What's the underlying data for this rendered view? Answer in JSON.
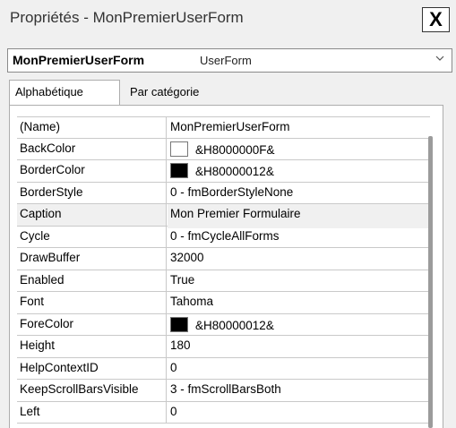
{
  "window": {
    "title": "Propriétés - MonPremierUserForm",
    "close_label": "X"
  },
  "object_selector": {
    "name": "MonPremierUserForm",
    "type": "UserForm"
  },
  "tabs": [
    {
      "label": "Alphabétique",
      "active": true
    },
    {
      "label": "Par catégorie",
      "active": false
    }
  ],
  "properties": [
    {
      "name": "(Name)",
      "value": "MonPremierUserForm"
    },
    {
      "name": "BackColor",
      "value": "&H8000000F&",
      "swatch": "#ffffff"
    },
    {
      "name": "BorderColor",
      "value": "&H80000012&",
      "swatch": "#000000"
    },
    {
      "name": "BorderStyle",
      "value": "0 - fmBorderStyleNone"
    },
    {
      "name": "Caption",
      "value": "Mon Premier Formulaire",
      "selected": true
    },
    {
      "name": "Cycle",
      "value": "0 - fmCycleAllForms"
    },
    {
      "name": "DrawBuffer",
      "value": "32000"
    },
    {
      "name": "Enabled",
      "value": "True"
    },
    {
      "name": "Font",
      "value": "Tahoma"
    },
    {
      "name": "ForeColor",
      "value": "&H80000012&",
      "swatch": "#000000"
    },
    {
      "name": "Height",
      "value": "180"
    },
    {
      "name": "HelpContextID",
      "value": "0"
    },
    {
      "name": "KeepScrollBarsVisible",
      "value": "3 - fmScrollBarsBoth"
    },
    {
      "name": "Left",
      "value": "0"
    }
  ]
}
